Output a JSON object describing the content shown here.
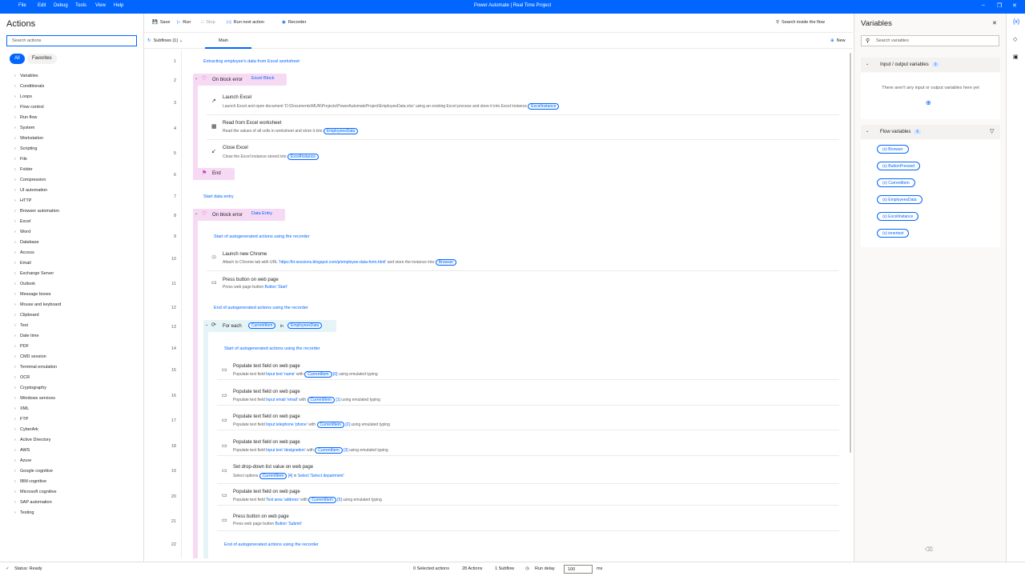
{
  "titlebar": {
    "menu": [
      "File",
      "Edit",
      "Debug",
      "Tools",
      "View",
      "Help"
    ],
    "title": "Power Automate | Real Time Project",
    "controls": [
      "minimize-icon",
      "restore-icon",
      "close-icon"
    ]
  },
  "actions_pane": {
    "title": "Actions",
    "search_placeholder": "Search actions",
    "filter_all": "All",
    "filter_favorites": "Favorites",
    "groups": [
      "Variables",
      "Conditionals",
      "Loops",
      "Flow control",
      "Run flow",
      "System",
      "Workstation",
      "Scripting",
      "File",
      "Folder",
      "Compression",
      "UI automation",
      "HTTP",
      "Browser automation",
      "Excel",
      "Word",
      "Database",
      "Access",
      "Email",
      "Exchange Server",
      "Outlook",
      "Message boxes",
      "Mouse and keyboard",
      "Clipboard",
      "Text",
      "Date time",
      "PDF",
      "CMD session",
      "Terminal emulation",
      "OCR",
      "Cryptography",
      "Windows services",
      "XML",
      "FTP",
      "CyberArk",
      "Active Directory",
      "AWS",
      "Azure",
      "Google cognitive",
      "IBM cognitive",
      "Microsoft cognitive",
      "SAP automation",
      "Testing"
    ]
  },
  "toolbar": {
    "save": "Save",
    "run": "Run",
    "stop": "Stop",
    "run_next": "Run next action",
    "recorder": "Recorder",
    "search_flow": "Search inside the flow"
  },
  "tabs": {
    "subflows": "Subflows (1)",
    "main": "Main",
    "new": "New"
  },
  "flow": {
    "r1": "Extracting employee's data from Excel worksheet",
    "r2_title": "On block error",
    "r2_name": "Excel Block",
    "r3_title": "Launch Excel",
    "r3_desc": "Launch Excel and open document 'D:\\Documents\\MUN\\Projects\\PowerAutomateProject\\EmployeeData.xlsx' using an existing Excel process and store it into Excel instance",
    "r3_var": "ExcelInstance",
    "r4_title": "Read from Excel worksheet",
    "r4_desc": "Read the values of all cells in worksheet and store it into",
    "r4_var": "EmployeesData",
    "r5_title": "Close Excel",
    "r5_desc": "Close the Excel instance stored into",
    "r5_var": "ExcelInstance",
    "r6_title": "End",
    "r7": "Start data entry",
    "r8_title": "On block error",
    "r8_name": "Data Entry",
    "r9": "Start of autogenerated actions using the recorder",
    "r10_title": "Launch new Chrome",
    "r10_desc_a": "Attach to Chrome tab with URL",
    "r10_url": "'https://kt-sessions.blogspot.com/p/employee-data-form.html'",
    "r10_desc_b": "and store the instance into",
    "r10_var": "Browser",
    "r11_title": "Press button on web page",
    "r11_desc": "Press web page button",
    "r11_hl": "Button 'Start'",
    "r12": "End of autogenerated actions using the recorder",
    "r13_title": "For each",
    "r13_var1": "CurrentItem",
    "r13_in": "in",
    "r13_var2": "EmployeesData",
    "r14": "Start of autogenerated actions using the recorder",
    "r15_title": "Populate text field on web page",
    "r15_a": "Populate text field",
    "r15_hl": "Input text 'name'",
    "r15_with": "with",
    "r15_var": "CurrentItem",
    "r15_idx": "[0]",
    "r15_tail": "using emulated typing",
    "r16_title": "Populate text field on web page",
    "r16_a": "Populate text field",
    "r16_hl": "Input email 'email'",
    "r16_with": "with",
    "r16_var": "CurrentItem",
    "r16_idx": "[1]",
    "r16_tail": "using emulated typing",
    "r17_title": "Populate text field on web page",
    "r17_a": "Populate text field",
    "r17_hl": "Input telephone 'phone'",
    "r17_with": "with",
    "r17_var": "CurrentItem",
    "r17_idx": "[2]",
    "r17_tail": "using emulated typing",
    "r18_title": "Populate text field on web page",
    "r18_a": "Populate text field",
    "r18_hl": "Input text 'designation'",
    "r18_with": "with",
    "r18_var": "CurrentItem",
    "r18_idx": "[3]",
    "r18_tail": "using emulated typing",
    "r19_title": "Set drop-down list value on web page",
    "r19_a": "Select options",
    "r19_var": "CurrentItem",
    "r19_idx": "[4]",
    "r19_in": "in",
    "r19_hl": "Select 'Select department'",
    "r20_title": "Populate text field on web page",
    "r20_a": "Populate text field",
    "r20_hl": "Text area 'address'",
    "r20_with": "with",
    "r20_var": "CurrentItem",
    "r20_idx": "[5]",
    "r20_tail": "using emulated typing",
    "r21_title": "Press button on web page",
    "r21_desc": "Press web page button",
    "r21_hl": "Button 'Submit'",
    "r22": "End of autogenerated actions using the recorder",
    "line_numbers": [
      "1",
      "2",
      "3",
      "4",
      "5",
      "6",
      "7",
      "8",
      "9",
      "10",
      "11",
      "12",
      "13",
      "14",
      "15",
      "16",
      "17",
      "18",
      "19",
      "20",
      "21",
      "22"
    ]
  },
  "variables_pane": {
    "title": "Variables",
    "search_placeholder": "Search variables",
    "io_title": "Input / output variables",
    "io_count": "0",
    "io_empty": "There aren't any input or output variables here yet",
    "flow_title": "Flow variables",
    "flow_count": "6",
    "flow_vars": [
      "Browser",
      "ButtonPressed",
      "CurrentItem",
      "EmployeesData",
      "ExcelInstance",
      "innertext"
    ]
  },
  "status": {
    "state": "Status: Ready",
    "selected": "0 Selected actions",
    "actions": "28 Actions",
    "subflow": "1 Subflow",
    "run_delay_label": "Run delay",
    "run_delay_value": "100",
    "unit": "ms"
  },
  "colors": {
    "accent": "#0066ff",
    "block": "#f6d9f3",
    "loop": "#e5f4f7"
  }
}
